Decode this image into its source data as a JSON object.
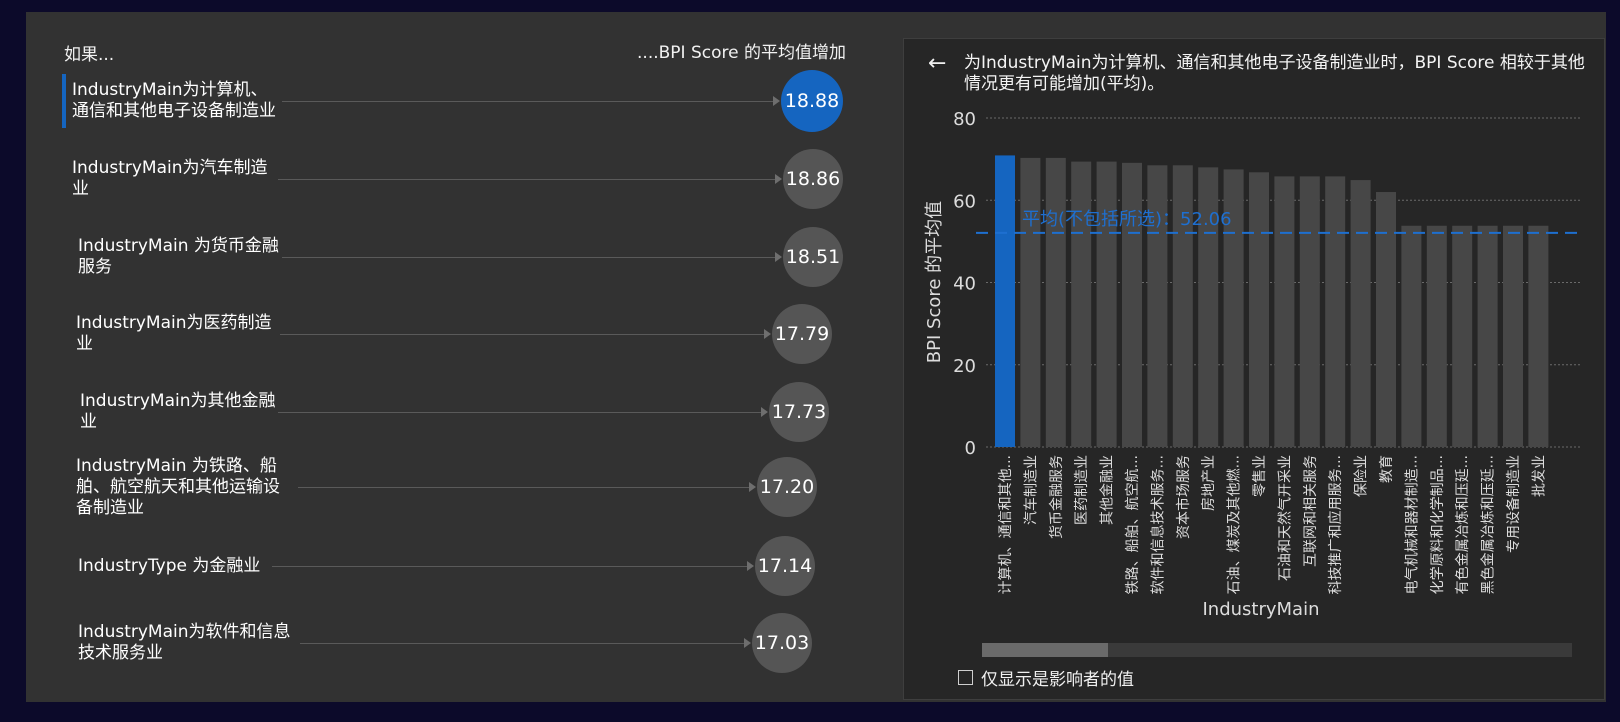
{
  "header": {
    "left": "如果...",
    "right": "....BPI Score 的平均值增加"
  },
  "influencers": [
    {
      "label": "IndustryMain为计算机、\n通信和其他电子设备制造业",
      "value": "18.88",
      "selected": true
    },
    {
      "label": "IndustryMain为汽车制造\n业",
      "value": "18.86",
      "selected": false
    },
    {
      "label": "IndustryMain 为货币金融\n服务",
      "value": "18.51",
      "selected": false
    },
    {
      "label": "IndustryMain为医药制造\n业",
      "value": "17.79",
      "selected": false
    },
    {
      "label": "IndustryMain为其他金融\n业",
      "value": "17.73",
      "selected": false
    },
    {
      "label": "IndustryMain 为铁路、船\n舶、航空航天和其他运输设\n备制造业",
      "value": "17.20",
      "selected": false
    },
    {
      "label": "IndustryType 为金融业",
      "value": "17.14",
      "selected": false
    },
    {
      "label": "IndustryMain为软件和信息\n技术服务业",
      "value": "17.03",
      "selected": false
    }
  ],
  "detail": {
    "back_label": "←",
    "title": "为IndustryMain为计算机、通信和其他电子设备制造业时，BPI Score 相较于其他情况更有可能增加(平均)。",
    "checkbox_label": "仅显示是影响者的值"
  },
  "colors": {
    "selected": "#1565c0",
    "bar": "#474747",
    "circle": "#555555",
    "avg_line": "#1e6fd0"
  },
  "chart_data": {
    "type": "bar",
    "xlabel": "IndustryMain",
    "ylabel": "BPI Score 的平均值",
    "ylim": [
      0,
      80
    ],
    "yticks": [
      0,
      20,
      40,
      60,
      80
    ],
    "grid": true,
    "average_label": "平均(不包括所选)：52.06",
    "average_value": 52.06,
    "categories": [
      "计算机、通信和其他...",
      "汽车制造业",
      "货币金融服务",
      "医药制造业",
      "其他金融业",
      "铁路、船舶、航空航...",
      "软件和信息技术服务...",
      "资本市场服务",
      "房地产业",
      "石油、煤炭及其他燃...",
      "零售业",
      "石油和天然气开采业",
      "互联网和相关服务",
      "科技推广和应用服务...",
      "保险业",
      "教育",
      "电气机械和器材制造...",
      "化学原料和化学制品...",
      "有色金属冶炼和压延...",
      "黑色金属冶炼和压延...",
      "专用设备制造业",
      "批发业"
    ],
    "values": [
      70.9,
      70.3,
      70.3,
      69.4,
      69.4,
      69.1,
      68.5,
      68.5,
      68.0,
      67.5,
      66.8,
      65.8,
      65.8,
      65.8,
      64.9,
      62.0,
      53.8,
      53.8,
      53.8,
      53.8,
      53.8,
      53.8
    ],
    "selected_index": 0
  }
}
